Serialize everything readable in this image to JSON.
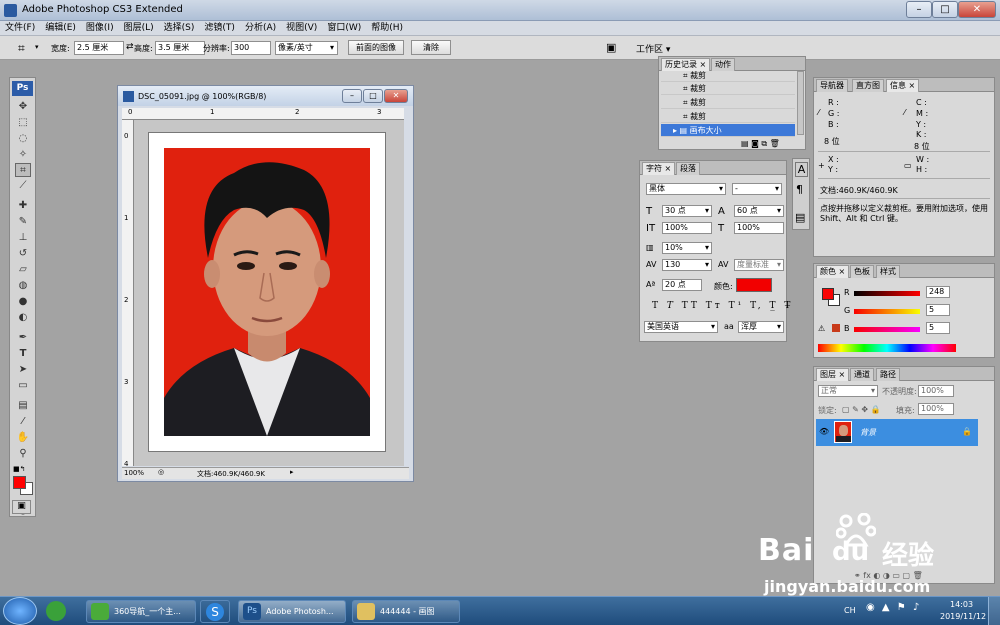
{
  "app": {
    "title": "Adobe Photoshop CS3 Extended",
    "logo": "Ps"
  },
  "menu": [
    "文件(F)",
    "编辑(E)",
    "图像(I)",
    "图层(L)",
    "选择(S)",
    "滤镜(T)",
    "分析(A)",
    "视图(V)",
    "窗口(W)",
    "帮助(H)"
  ],
  "options": {
    "width_label": "宽度:",
    "width_value": "2.5 厘米",
    "height_label": "高度:",
    "height_value": "3.5 厘米",
    "resolution_label": "分辨率:",
    "resolution_value": "300",
    "unit": "像素/英寸",
    "front_image": "前面的图像",
    "clear": "清除",
    "workspace": "工作区"
  },
  "document": {
    "title": "DSC_05091.jpg @ 100%(RGB/8)",
    "zoom": "100%",
    "doc_info": "文档:460.9K/460.9K"
  },
  "history": {
    "tabs": [
      "历史记录",
      "动作"
    ],
    "items": [
      "裁剪",
      "裁剪",
      "裁剪",
      "裁剪",
      "画布大小"
    ]
  },
  "character": {
    "tabs": [
      "字符",
      "段落"
    ],
    "font": "黑体",
    "style": "-",
    "size": "30 点",
    "leading": "60 点",
    "vscale": "100%",
    "hscale": "100%",
    "baseline_shift": "10%",
    "kerning": "130",
    "tracking": "度量标准",
    "indent": "20 点",
    "color_label": "颜色:",
    "language": "美国英语",
    "aa_label": "aa",
    "antialias": "浑厚",
    "text_color": "#ff0000"
  },
  "info": {
    "tabs": [
      "导航器",
      "直方图",
      "信息"
    ],
    "r": "R :",
    "g": "G :",
    "b": "B :",
    "c": "C :",
    "m": "M :",
    "y": "Y :",
    "k": "K :",
    "bit1": "8 位",
    "bit2": "8 位",
    "x": "X :",
    "yy": "Y :",
    "w": "W :",
    "h": "H :",
    "doc": "文档:460.9K/460.9K",
    "hint": "点按并拖移以定义裁剪框。要用附加选项，使用 Shift、Alt 和 Ctrl 键。"
  },
  "color_panel": {
    "tabs": [
      "颜色",
      "色板",
      "样式"
    ],
    "r_label": "R",
    "g_label": "G",
    "b_label": "B",
    "r": "248",
    "g": "5",
    "b": "5",
    "fg": "#f80505"
  },
  "layers": {
    "tabs": [
      "图层",
      "通道",
      "路径"
    ],
    "blend": "正常",
    "opacity_label": "不透明度:",
    "opacity": "100%",
    "lock_label": "锁定:",
    "fill_label": "填充:",
    "fill": "100%",
    "layer_name": "背景"
  },
  "taskbar": {
    "items": [
      "360导航_一个主...",
      "Adobe Photosh...",
      "444444 - 画图"
    ],
    "time": "14:03",
    "date": "2019/11/12",
    "lang": "CH"
  },
  "watermark": {
    "text1": "Bai",
    "text2": "du",
    "text3": "经验",
    "url": "jingyan.baidu.com"
  }
}
